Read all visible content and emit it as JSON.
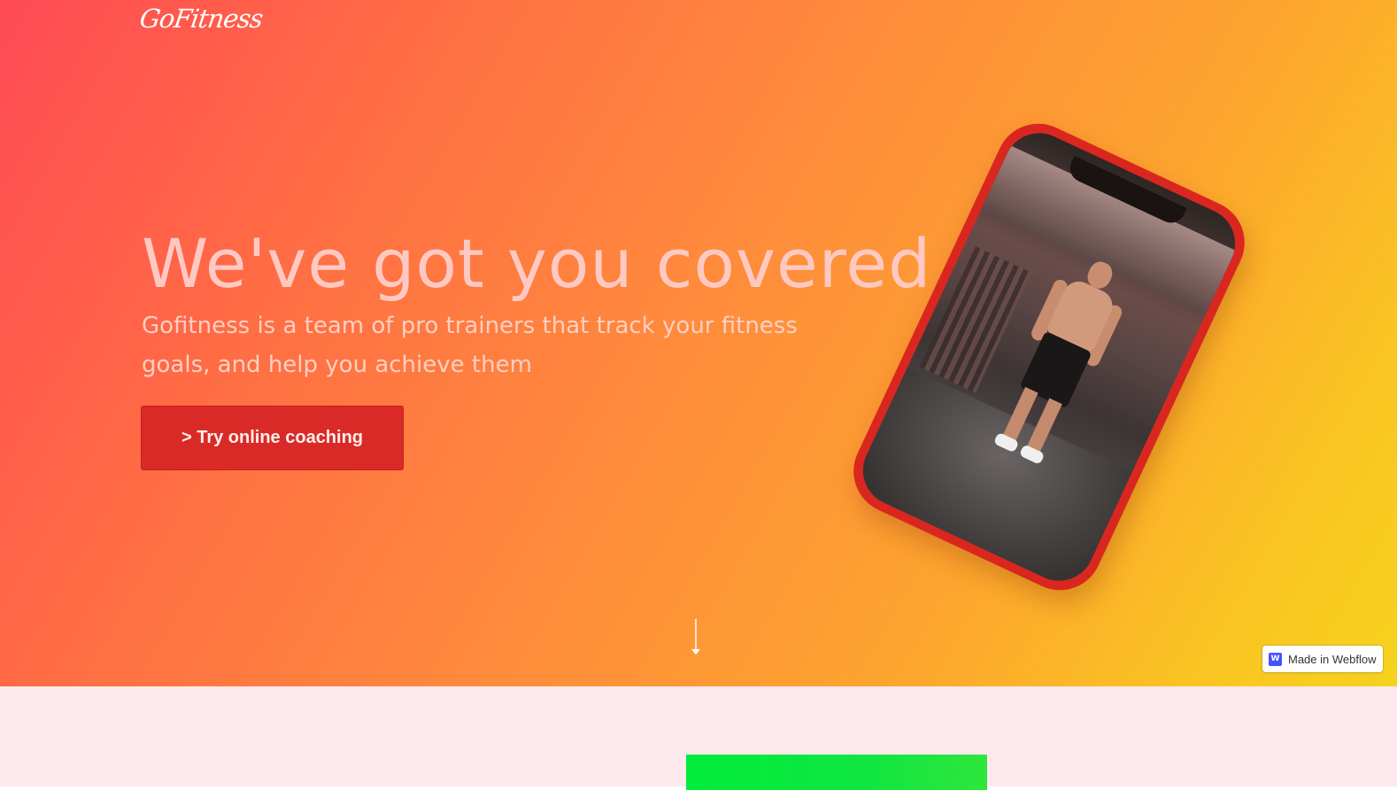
{
  "brand": {
    "logo_text": "GoFitness"
  },
  "hero": {
    "headline": "We've got you covered",
    "subtext": "Gofitness is a team of pro trainers that track your fitness goals, and help you achieve them",
    "cta_label": "> Try online coaching"
  },
  "badge": {
    "logo_letter": "W",
    "label": "Made in Webflow"
  },
  "colors": {
    "gradient_start": "#ff4a55",
    "gradient_end": "#f6d21e",
    "cta_background": "#da2a28",
    "phone_body": "#d9271f",
    "lower_section_bg": "#fde8ec",
    "green_block": "#00ec3c"
  },
  "icons": {
    "scroll": "arrow-down-icon",
    "webflow": "webflow-logo-icon"
  }
}
